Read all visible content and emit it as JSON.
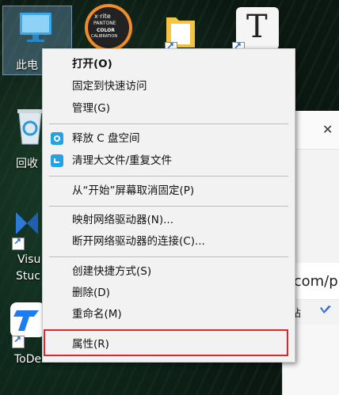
{
  "desktop": {
    "icons": [
      {
        "label": "此电"
      },
      {
        "label": "回收"
      },
      {
        "label": "Visu"
      },
      {
        "label": "Stuc"
      },
      {
        "label": "ToDesk"
      }
    ],
    "xrite": {
      "brand": "x·rite",
      "line1": "PANTONE",
      "line2": "COLOR",
      "line3": "CALIBRATION"
    },
    "typora_letter": "T"
  },
  "browser": {
    "close_glyph": "✕",
    "url_fragment": ".com/pr",
    "bookmark_fragment": "站"
  },
  "context_menu": {
    "items": [
      {
        "label": "打开(O)",
        "bold": true
      },
      {
        "label": "固定到快速访问"
      },
      {
        "label": "管理(G)"
      },
      {
        "label": "释放 C 盘空间",
        "icon": "cleanup-icon"
      },
      {
        "label": "清理大文件/重复文件",
        "icon": "files-icon"
      },
      {
        "label": "从“开始”屏幕取消固定(P)"
      },
      {
        "label": "映射网络驱动器(N)..."
      },
      {
        "label": "断开网络驱动器的连接(C)..."
      },
      {
        "label": "创建快捷方式(S)"
      },
      {
        "label": "删除(D)"
      },
      {
        "label": "重命名(M)"
      },
      {
        "label": "属性(R)"
      }
    ]
  },
  "colors": {
    "highlight_border": "#e0262b",
    "menu_bg": "#f2f2f2",
    "accent_icon": "#27a1e6"
  }
}
